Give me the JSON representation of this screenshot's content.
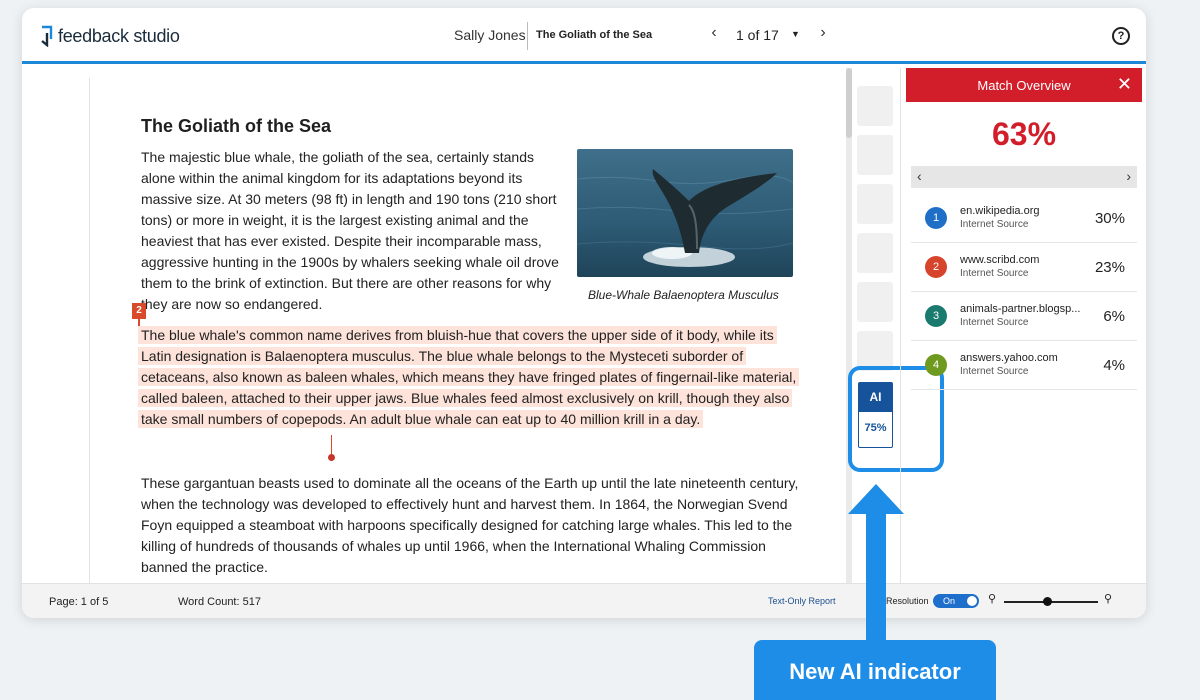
{
  "app": {
    "logo_text": "feedback studio"
  },
  "header": {
    "author": "Sally Jones",
    "doc_title": "The Goliath of the Sea",
    "pager": "1 of 17"
  },
  "document": {
    "title": "The Goliath of the Sea",
    "p1": "The majestic blue whale, the goliath of the sea, certainly stands alone within the animal kingdom for its adaptations beyond its massive size. At 30 meters (98 ft) in length and 190 tons (210 short tons) or more in weight, it is the largest existing animal and the heaviest that has ever existed. Despite their incomparable mass, aggressive hunting in the 1900s by whalers seeking whale oil drove them to the brink of extinction. But there are other reasons for why they are now so endangered.",
    "image_caption": "Blue-Whale Balaenoptera Musculus",
    "highlight_marker": "2",
    "p2_highlighted": "The blue whale's common name derives from bluish-hue that covers the upper side of it body, while its Latin designation is Balaenoptera musculus. The blue whale belongs to the Mysteceti suborder of cetaceans, also known as baleen whales, which means they have fringed plates of fingernail-like material, called baleen, attached to their upper jaws. Blue whales feed almost exclusively on krill, though they also take small numbers of copepods. An adult blue whale can eat up to 40 million krill in a day.",
    "p3": "These gargantuan beasts used to dominate all the oceans of the Earth up until the late nineteenth century, when the technology was developed to effectively hunt and harvest them. In 1864, the Norwegian Svend Foyn equipped a steamboat with harpoons specifically designed for catching large whales. This led to the killing of hundreds of thousands of whales up until 1966, when the International Whaling Commission banned the practice."
  },
  "ai_indicator": {
    "label": "AI",
    "value": "75%"
  },
  "match_overview": {
    "title": "Match Overview",
    "score": "63%",
    "sources": [
      {
        "num": "1",
        "name": "en.wikipedia.org",
        "type": "Internet Source",
        "pct": "30%",
        "color": "#1f6fc8"
      },
      {
        "num": "2",
        "name": "www.scribd.com",
        "type": "Internet Source",
        "pct": "23%",
        "color": "#d6442b"
      },
      {
        "num": "3",
        "name": "animals-partner.blogsp...",
        "type": "Internet Source",
        "pct": "6%",
        "color": "#1a7a6e"
      },
      {
        "num": "4",
        "name": "answers.yahoo.com",
        "type": "Internet Source",
        "pct": "4%",
        "color": "#6f9a20"
      }
    ]
  },
  "footer": {
    "page": "Page: 1 of 5",
    "word_count": "Word Count: 517",
    "text_only": "Text-Only Report",
    "resolution_label": "Resolution",
    "resolution_toggle": "On"
  },
  "callout": {
    "label": "New AI indicator"
  },
  "colors": {
    "accent_blue": "#1e88d8",
    "match_red": "#d21e2b",
    "highlight_bg": "#fde3da",
    "ai_blue": "#16539a"
  },
  "icons": [
    "logo-icon",
    "chevron-left-icon",
    "caret-down-icon",
    "chevron-right-icon",
    "help-icon",
    "close-icon",
    "zoom-out-icon",
    "zoom-in-icon",
    "arrow-up-icon"
  ]
}
